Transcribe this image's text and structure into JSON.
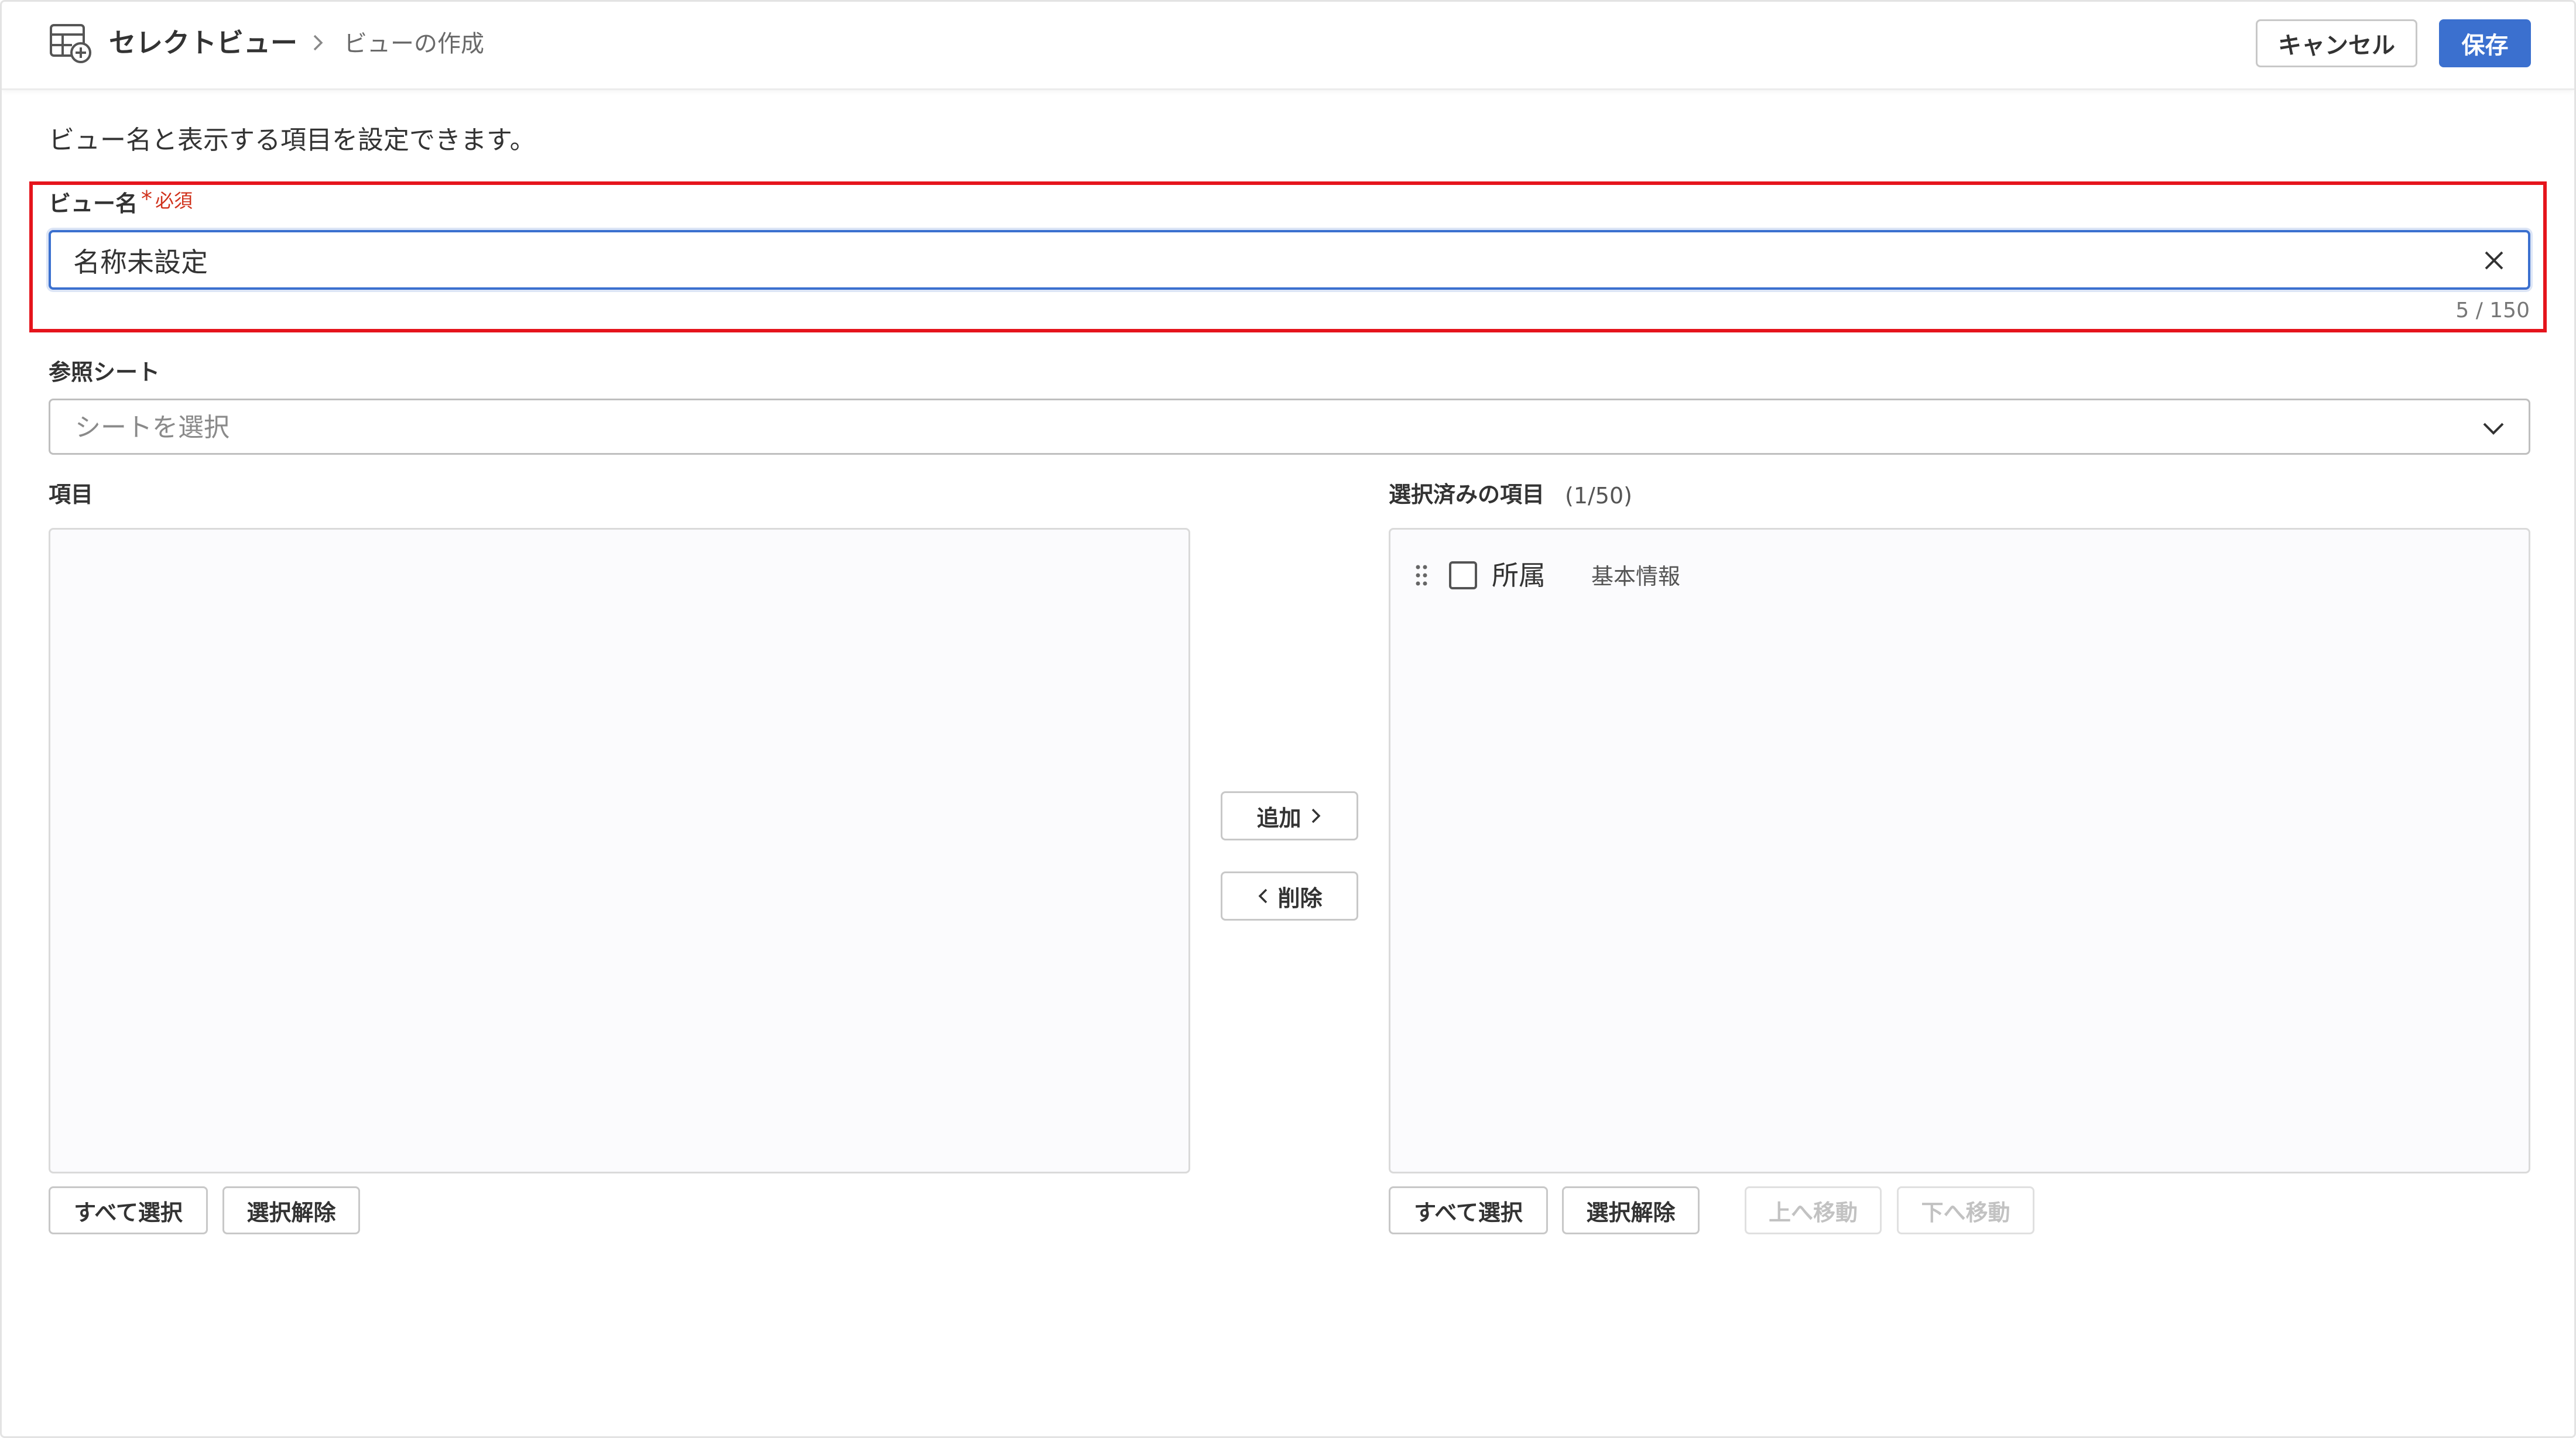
{
  "header": {
    "title": "セレクトビュー",
    "subtitle": "ビューの作成",
    "cancel_label": "キャンセル",
    "save_label": "保存"
  },
  "description": "ビュー名と表示する項目を設定できます。",
  "view_name": {
    "label": "ビュー名",
    "required_mark": "*",
    "required_text": "必須",
    "value": "名称未設定",
    "char_count": "5 / 150"
  },
  "sheet": {
    "label": "参照シート",
    "placeholder": "シートを選択"
  },
  "items_panel": {
    "label": "項目",
    "select_all_label": "すべて選択",
    "deselect_label": "選択解除"
  },
  "transfer": {
    "add_label": "追加",
    "remove_label": "削除"
  },
  "selected_panel": {
    "label": "選択済みの項目",
    "count": "(1/50)",
    "items": [
      {
        "name": "所属",
        "category": "基本情報",
        "checked": false
      }
    ],
    "select_all_label": "すべて選択",
    "deselect_label": "選択解除",
    "move_up_label": "上へ移動",
    "move_down_label": "下へ移動"
  },
  "colors": {
    "primary": "#3b70cf",
    "required": "#d0321c",
    "highlight_border": "#e5141c"
  }
}
